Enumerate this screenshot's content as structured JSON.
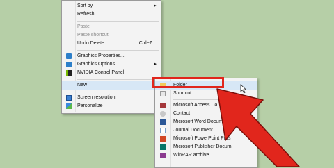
{
  "context_menu": {
    "items": [
      {
        "label": "Sort by"
      },
      {
        "label": "Refresh"
      },
      {
        "label": "Paste"
      },
      {
        "label": "Paste shortcut"
      },
      {
        "label": "Undo Delete",
        "shortcut": "Ctrl+Z"
      },
      {
        "label": "Graphics Properties..."
      },
      {
        "label": "Graphics Options"
      },
      {
        "label": "NVIDIA Control Panel"
      },
      {
        "label": "New"
      },
      {
        "label": "Screen resolution"
      },
      {
        "label": "Personalize"
      }
    ]
  },
  "new_submenu": {
    "items": [
      {
        "label": "Folder"
      },
      {
        "label": "Shortcut"
      },
      {
        "label": "Microsoft Access Da"
      },
      {
        "label": "Contact"
      },
      {
        "label": "Microsoft Word Documen"
      },
      {
        "label": "Journal Document"
      },
      {
        "label": "Microsoft PowerPoint Pres"
      },
      {
        "label": "Microsoft Publisher Docum"
      },
      {
        "label": "WinRAR archive"
      }
    ]
  },
  "colors": {
    "background": "#b6cfa7",
    "highlight_border": "#e1261c",
    "arrow": "#e1261c",
    "menu_hover": "#d7e7f6"
  }
}
